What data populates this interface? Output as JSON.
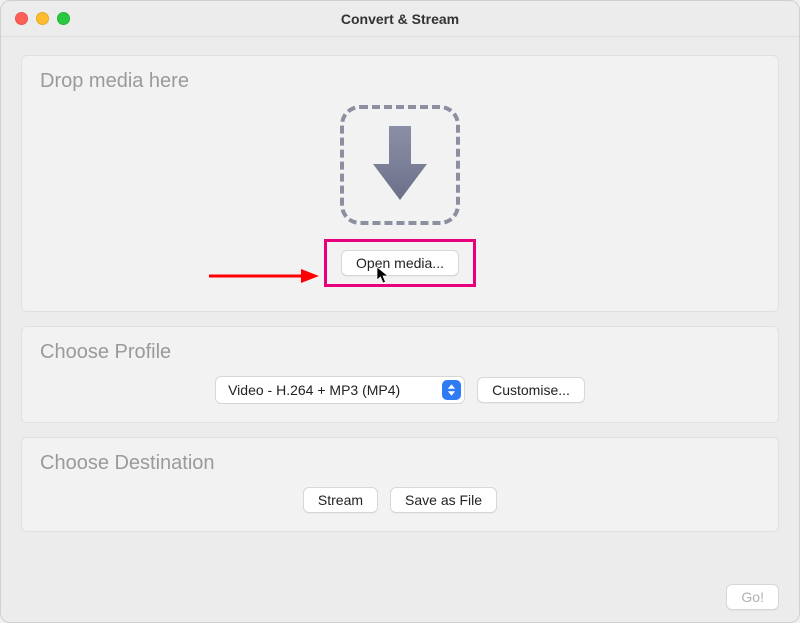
{
  "window": {
    "title": "Convert & Stream"
  },
  "drop_section": {
    "title": "Drop media here",
    "open_media_label": "Open media..."
  },
  "profile_section": {
    "title": "Choose Profile",
    "selected": "Video - H.264 + MP3 (MP4)",
    "customise_label": "Customise..."
  },
  "destination_section": {
    "title": "Choose Destination",
    "stream_label": "Stream",
    "save_label": "Save as File"
  },
  "footer": {
    "go_label": "Go!"
  },
  "colors": {
    "annotation_highlight": "#e6007e",
    "annotation_arrow": "#ff0000",
    "accent": "#2f7bf6",
    "arrow_fill": "#767b94"
  }
}
